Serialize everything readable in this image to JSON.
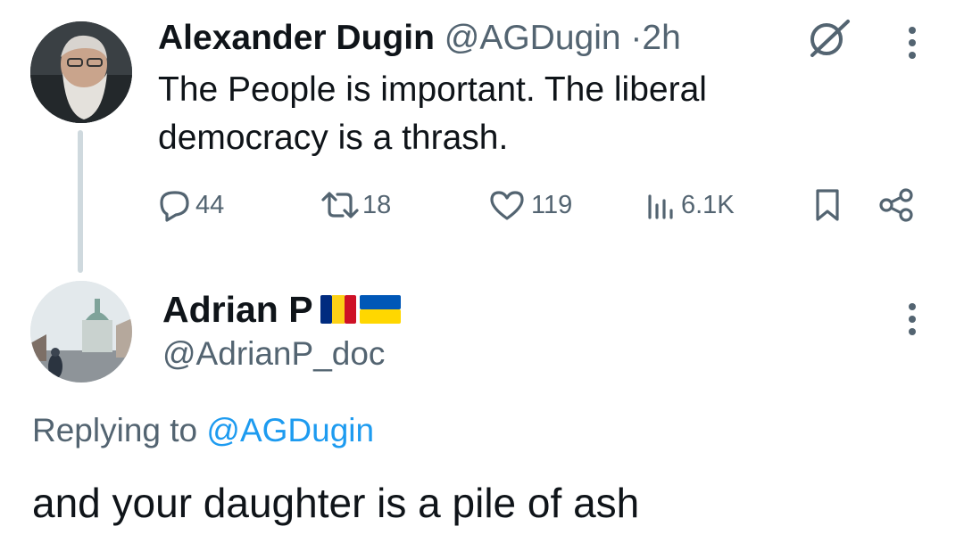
{
  "tweet": {
    "author_name": "Alexander Dugin",
    "author_handle": "@AGDugin",
    "separator": "·",
    "time": "2h",
    "text": "The People is important. The liberal democracy is a thrash.",
    "stats": {
      "replies": "44",
      "retweets": "18",
      "likes": "119",
      "views": "6.1K"
    },
    "icons": [
      "grok-icon",
      "more-icon",
      "reply-icon",
      "retweet-icon",
      "like-icon",
      "views-icon",
      "bookmark-icon",
      "share-icon"
    ]
  },
  "reply": {
    "author_name": "Adrian P",
    "flags": [
      "romania-flag",
      "ukraine-flag"
    ],
    "author_handle": "@AdrianP_doc",
    "replying_prefix": "Replying to",
    "replying_handle": "@AGDugin",
    "text": "and your daughter is a pile of ash"
  },
  "colors": {
    "text": "#0f1419",
    "muted": "#536471",
    "link": "#1d9bf0",
    "thread_line": "#cfd9de"
  }
}
